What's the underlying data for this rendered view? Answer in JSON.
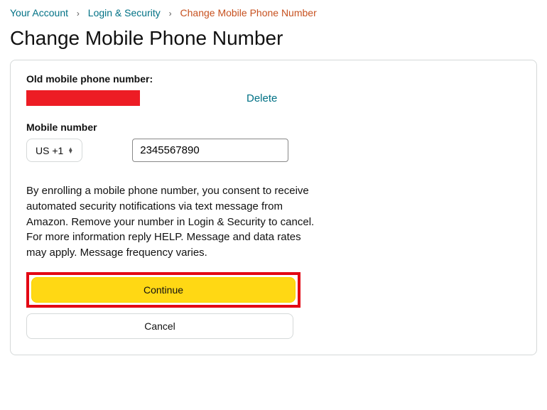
{
  "breadcrumb": {
    "your_account": "Your Account",
    "login_security": "Login & Security",
    "current": "Change Mobile Phone Number"
  },
  "page_title": "Change Mobile Phone Number",
  "old_number_label": "Old mobile phone number:",
  "delete_label": "Delete",
  "mobile_number_label": "Mobile number",
  "country_code": "US +1",
  "phone_value": "2345567890",
  "consent_text": "By enrolling a mobile phone number, you consent to receive automated security notifications via text message from Amazon. Remove your number in Login & Security to cancel. For more information reply HELP. Message and data rates may apply. Message frequency varies.",
  "continue_label": "Continue",
  "cancel_label": "Cancel"
}
